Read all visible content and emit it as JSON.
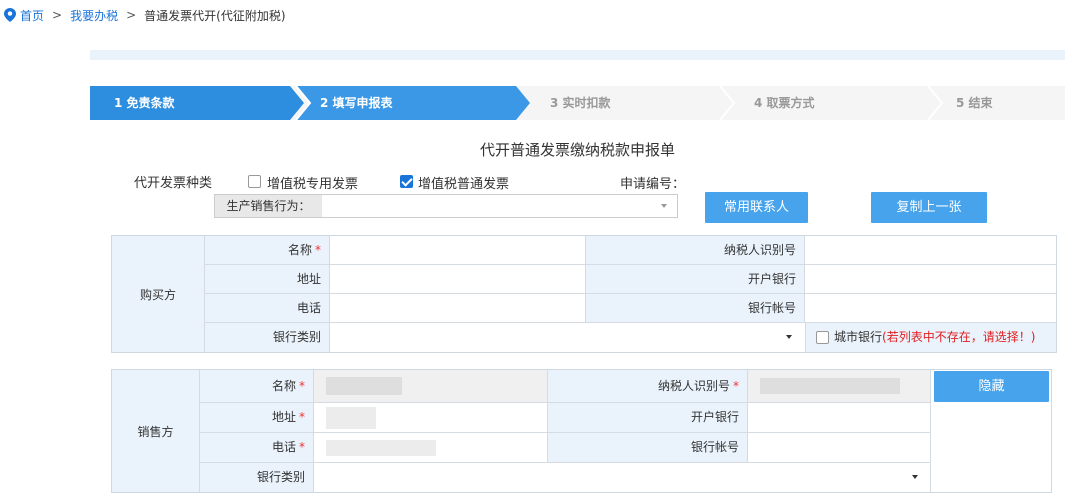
{
  "breadcrumb": {
    "home": "首页",
    "sep": ">",
    "level2": "我要办税",
    "current": "普通发票代开(代征附加税)"
  },
  "steps": [
    {
      "label": "1  免责条款",
      "state": "done"
    },
    {
      "label": "2  填写申报表",
      "state": "active"
    },
    {
      "label": "3  实时扣款",
      "state": "pending"
    },
    {
      "label": "4  取票方式",
      "state": "pending"
    },
    {
      "label": "5  结束",
      "state": "pending"
    }
  ],
  "form": {
    "title": "代开普通发票缴纳税款申报单",
    "invoice_type_label": "代开发票种类",
    "vat_special": {
      "label": "增值税专用发票",
      "checked": false
    },
    "vat_normal": {
      "label": "增值税普通发票",
      "checked": true
    },
    "apply_no_label": "申请编号：",
    "production_label": "生产销售行为：",
    "production_value": "",
    "contact_button": "常用联系人",
    "copy_button": "复制上一张"
  },
  "buyer": {
    "side_label": "购买方",
    "name_label": "名称",
    "name_required": "*",
    "tax_id_label": "纳税人识别号",
    "address_label": "地址",
    "bank_label": "开户银行",
    "phone_label": "电话",
    "account_label": "银行帐号",
    "bank_type_label": "银行类别",
    "city_bank_label": "城市银行",
    "city_bank_hint": "(若列表中不存在，请选择！)"
  },
  "seller": {
    "side_label": "销售方",
    "name_label": "名称",
    "required": "*",
    "tax_id_label": "纳税人识别号",
    "address_label": "地址",
    "bank_label": "开户银行",
    "phone_label": "电话",
    "account_label": "银行帐号",
    "bank_type_label": "银行类别",
    "hide_button": "隐藏"
  },
  "colors": {
    "accent": "#47a3ec",
    "step_active": "#2d8ee0",
    "link": "#1a73d9",
    "required": "#e33333"
  }
}
